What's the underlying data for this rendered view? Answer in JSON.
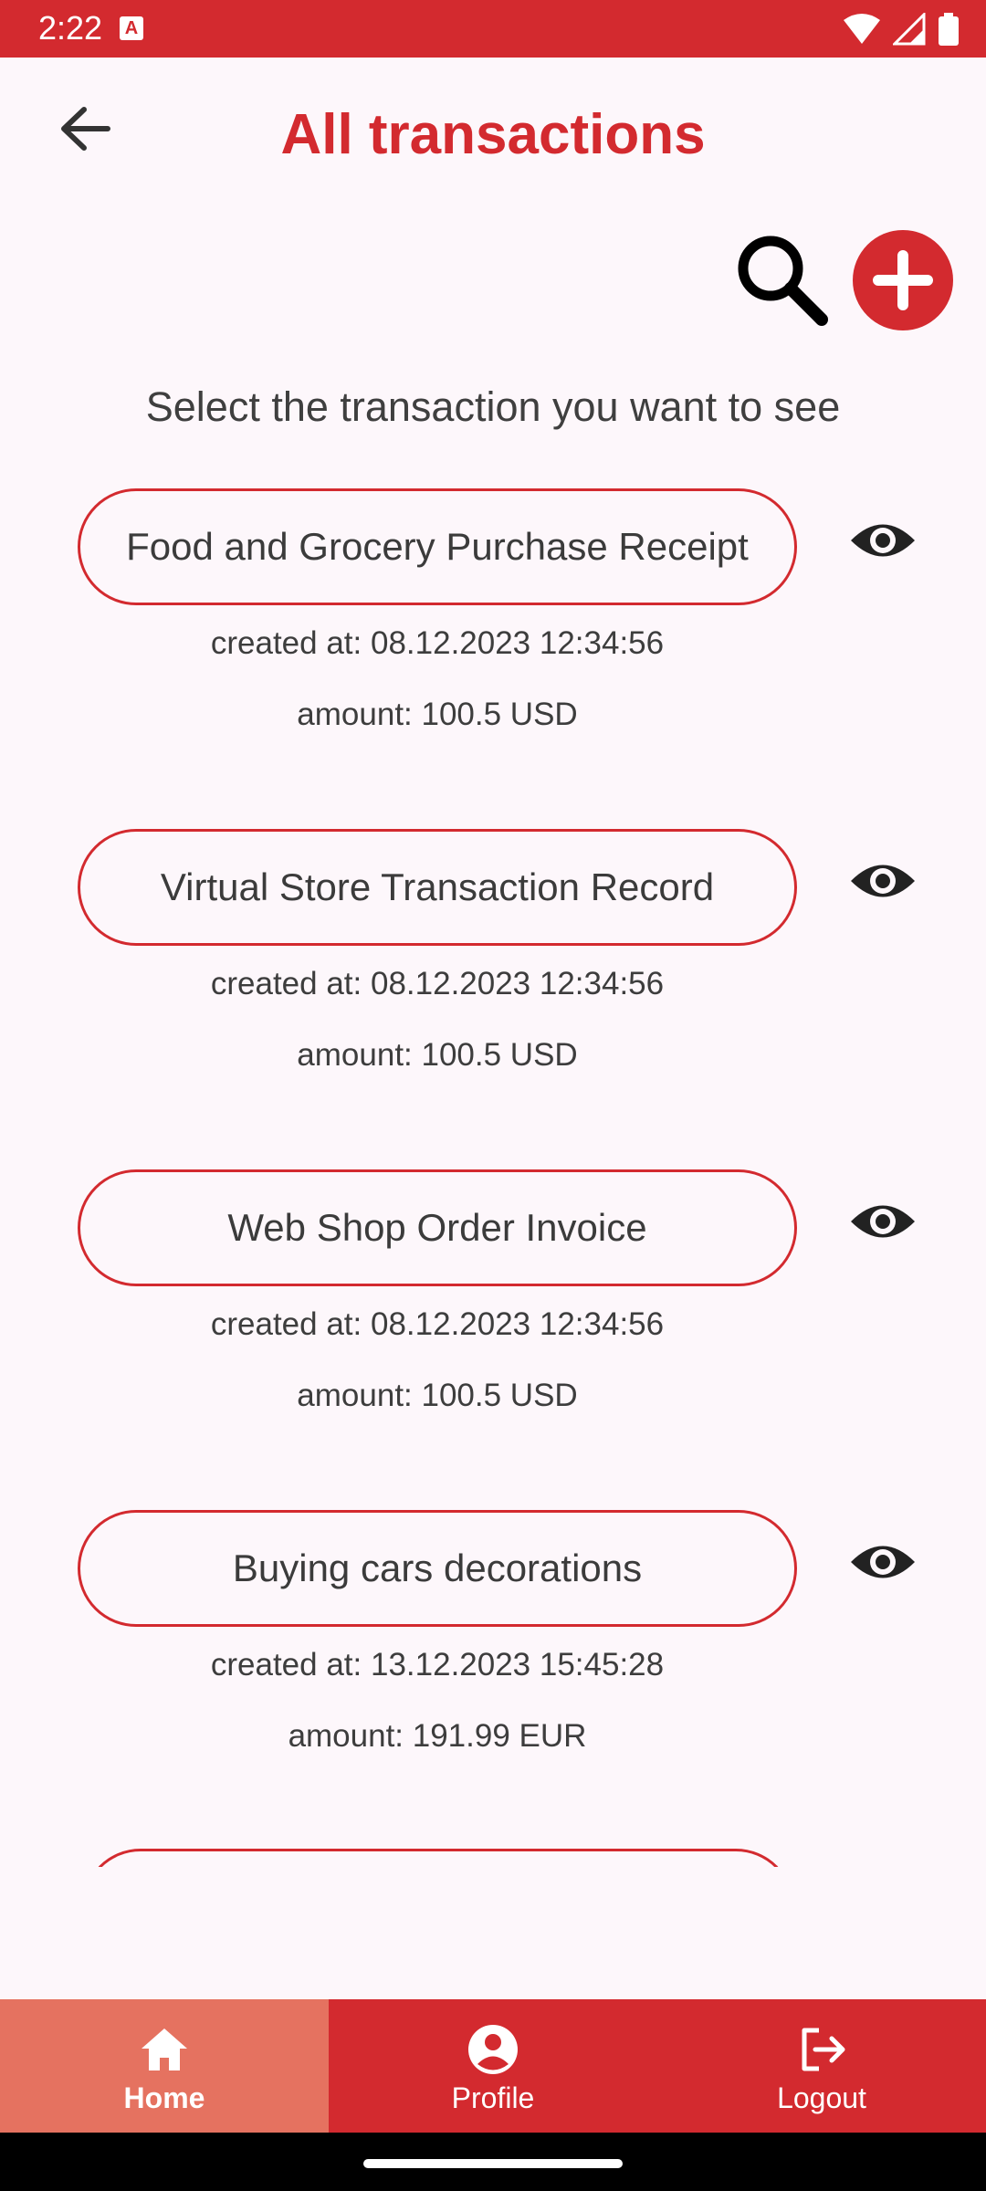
{
  "status_bar": {
    "time": "2:22",
    "notification_icon": "a-icon"
  },
  "header": {
    "title": "All transactions",
    "back_icon": "arrow-left-icon"
  },
  "actions": {
    "search_icon": "search-icon",
    "add_icon": "plus-circle-icon"
  },
  "instruction": "Select the transaction you want to see",
  "transactions": [
    {
      "name": "Food and Grocery Purchase Receipt",
      "created": "created at: 08.12.2023 12:34:56",
      "amount": "amount: 100.5 USD"
    },
    {
      "name": "Virtual Store Transaction Record",
      "created": "created at: 08.12.2023 12:34:56",
      "amount": "amount: 100.5 USD"
    },
    {
      "name": "Web Shop Order Invoice",
      "created": "created at: 08.12.2023 12:34:56",
      "amount": "amount: 100.5 USD"
    },
    {
      "name": "Buying cars decorations",
      "created": "created at: 13.12.2023 15:45:28",
      "amount": "amount: 191.99 EUR"
    }
  ],
  "nav": [
    {
      "label": "Home",
      "icon": "home-icon",
      "active": true
    },
    {
      "label": "Profile",
      "icon": "profile-icon",
      "active": false
    },
    {
      "label": "Logout",
      "icon": "logout-icon",
      "active": false
    }
  ],
  "colors": {
    "primary": "#d32a2f",
    "nav_active": "#e57260",
    "background": "#fdf7fb"
  }
}
